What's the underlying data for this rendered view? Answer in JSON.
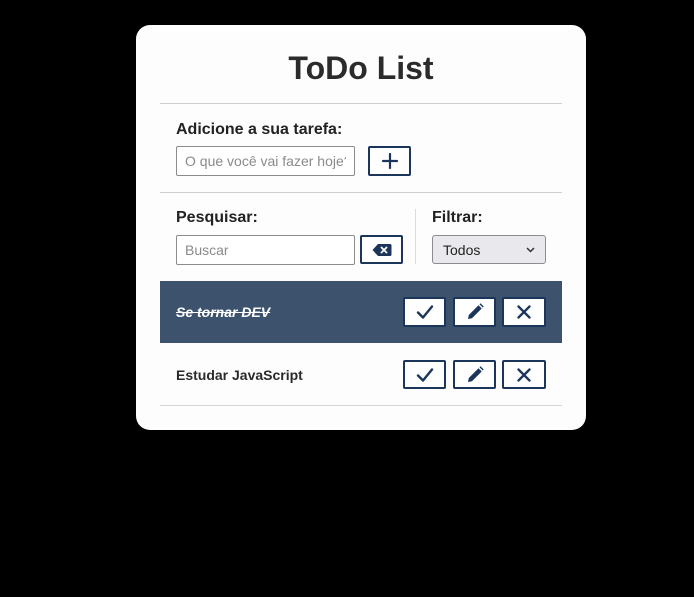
{
  "app": {
    "title": "ToDo List"
  },
  "add": {
    "label": "Adicione a sua tarefa:",
    "placeholder": "O que você vai fazer hoje?",
    "value": "",
    "button_icon": "plus-icon"
  },
  "search": {
    "label": "Pesquisar:",
    "placeholder": "Buscar",
    "value": "",
    "clear_icon": "backspace-icon"
  },
  "filter": {
    "label": "Filtrar:",
    "selected": "Todos"
  },
  "todos": [
    {
      "text": "Se tornar DEV",
      "done": true
    },
    {
      "text": "Estudar JavaScript",
      "done": false
    }
  ],
  "colors": {
    "accent": "#1c365b",
    "done_row": "#3c526d",
    "background": "#000000",
    "card": "#fdfdfd"
  },
  "icons": {
    "finish": "check-icon",
    "edit": "pencil-icon",
    "remove": "close-icon"
  }
}
